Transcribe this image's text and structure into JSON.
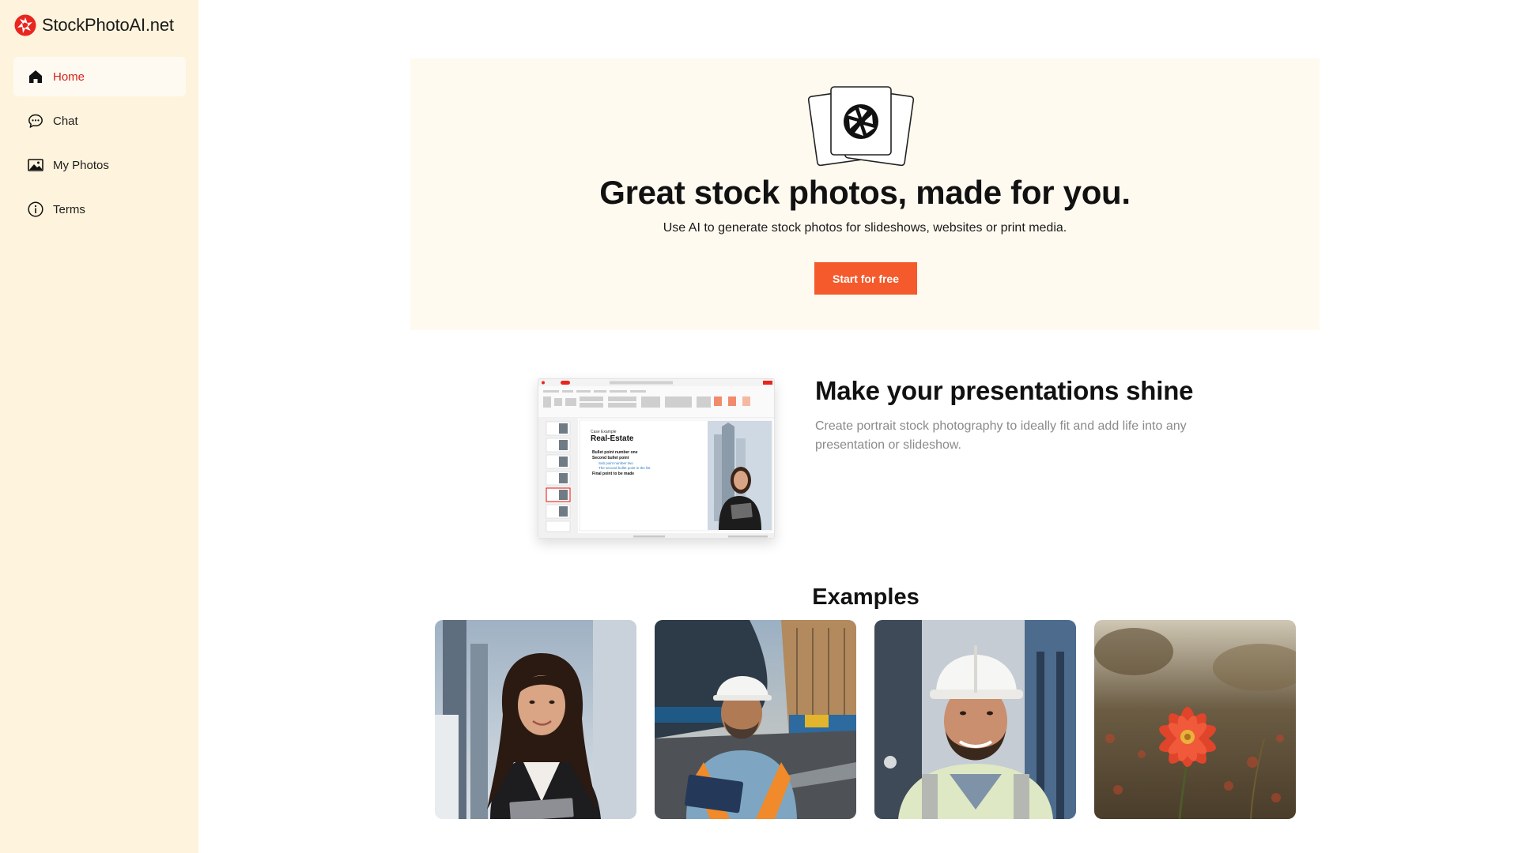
{
  "brand": {
    "name": "StockPhotoAI.net",
    "logo_icon": "aperture-logo-icon",
    "accent": "#e8261f"
  },
  "sidebar": {
    "items": [
      {
        "label": "Home",
        "icon": "home-icon",
        "active": true
      },
      {
        "label": "Chat",
        "icon": "chat-bubble-icon",
        "active": false
      },
      {
        "label": "My Photos",
        "icon": "image-icon",
        "active": false
      },
      {
        "label": "Terms",
        "icon": "info-icon",
        "active": false
      }
    ]
  },
  "hero": {
    "title": "Great stock photos, made for you.",
    "subtitle": "Use AI to generate stock photos for slideshows, websites or print media.",
    "cta_label": "Start for free",
    "cta_color": "#f45a2b"
  },
  "feature": {
    "title": "Make your presentations shine",
    "description": "Create portrait stock photography to ideally fit and add life into any presentation or slideshow.",
    "screenshot": {
      "slide_kicker": "Case Example",
      "slide_title": "Real-Estate",
      "bullets": [
        "Bullet point number one",
        "Second bullet point",
        "Sub point number two",
        "The second bullet point in the list",
        "Final point to be made"
      ]
    }
  },
  "examples": {
    "title": "Examples",
    "photos": [
      {
        "subject": "businesswoman-with-tablet"
      },
      {
        "subject": "construction-worker-at-shipyard"
      },
      {
        "subject": "smiling-engineer-in-hardhat"
      },
      {
        "subject": "red-flower-in-field"
      }
    ]
  }
}
